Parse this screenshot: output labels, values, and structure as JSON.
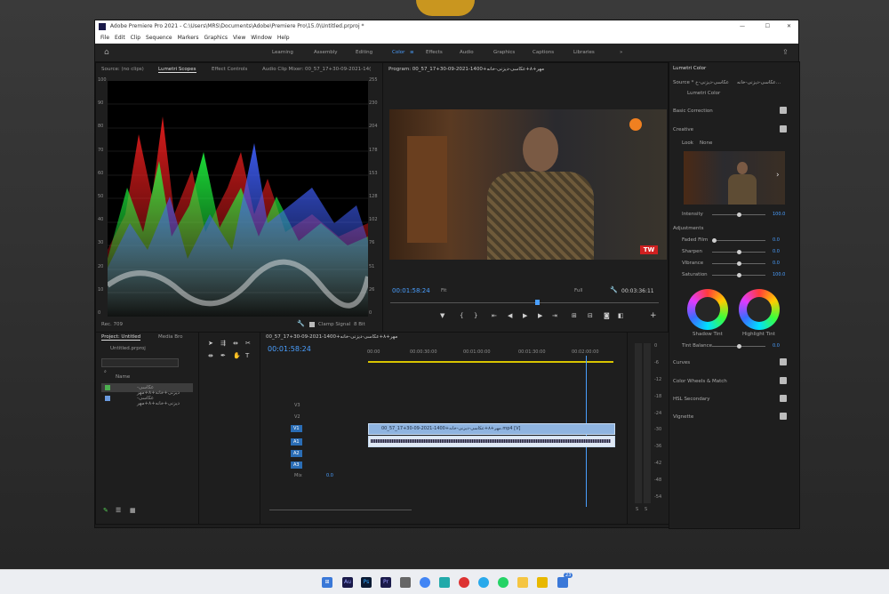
{
  "window": {
    "title": "Adobe Premiere Pro 2021 - C:\\Users\\MRS\\Documents\\Adobe\\Premiere Pro\\15.0\\Untitled.prproj *"
  },
  "menu": [
    "File",
    "Edit",
    "Clip",
    "Sequence",
    "Markers",
    "Graphics",
    "View",
    "Window",
    "Help"
  ],
  "workspaces": [
    "Learning",
    "Assembly",
    "Editing",
    "Color",
    "Effects",
    "Audio",
    "Graphics",
    "Captions",
    "Libraries"
  ],
  "source_panel": {
    "tabs": [
      "Source: (no clips)",
      "Lumetri Scopes",
      "Effect Controls",
      "Audio Clip Mixer: 00_57_17+30-09-2021-14("
    ],
    "left_scale": [
      "100",
      "90",
      "80",
      "70",
      "60",
      "50",
      "40",
      "30",
      "20",
      "10",
      "0"
    ],
    "right_scale": [
      "255",
      "230",
      "204",
      "178",
      "153",
      "128",
      "102",
      "76",
      "51",
      "26",
      "0"
    ],
    "footer_left": "Rec. 709",
    "clamp_label": "Clamp Signal",
    "bit_label": "8 Bit"
  },
  "program": {
    "title": "Program: 00_57_17+30-09-2021-1400+مهر+۸+عکاسی-دیزنی-خانه",
    "timecode": "00:01:58:24",
    "fit": "Fit",
    "quality": "Full",
    "duration": "00:03:36:11",
    "watermark": "TW"
  },
  "project": {
    "tabs": [
      "Project: Untitled",
      "Media Bro"
    ],
    "file": "Untitled.prproj",
    "column_name": "Name",
    "items": [
      "عکاسی-دیزنی+خانه+۸+مهر",
      "عکاسی-دیزنی+خانه+۸+مهر"
    ]
  },
  "timeline": {
    "tab": "00_57_17+30-09-2021-1400+مهر+۸+عکاسی-دیزنی-خانه",
    "timecode": "00:01:58:24",
    "ruler": [
      "00:00",
      "00:00:30:00",
      "00:01:00:00",
      "00:01:30:00",
      "00:02:00:00"
    ],
    "video_tracks": [
      "V3",
      "V2",
      "V1"
    ],
    "audio_tracks": [
      "A1",
      "A2",
      "A3"
    ],
    "mix_label": "Mix",
    "mix_value": "0.0",
    "video_clip": "00_57_17+30-09-2021-1400+مهر+۸+عکاسی-دیزنی-خانه.mp4 [V]",
    "meter_scale": [
      "0",
      "-6",
      "-12",
      "-18",
      "-24",
      "-30",
      "-36",
      "-42",
      "-48",
      "-54"
    ],
    "meter_solo": [
      "S",
      "S"
    ]
  },
  "lumetri": {
    "title": "Lumetri Color",
    "source": "Source * عکاسی-دیزنی-خ",
    "target": "عکاسی-دیزنی-خانه...",
    "effect": "Lumetri Color",
    "sections": [
      "Basic Correction",
      "Creative"
    ],
    "look_label": "Look",
    "look_value": "None",
    "intensity_label": "Intensity",
    "intensity_value": "100.0",
    "adjustments_label": "Adjustments",
    "adjustments": [
      {
        "label": "Faded Film",
        "value": "0.0",
        "level": 0.0
      },
      {
        "label": "Sharpen",
        "value": "0.0",
        "level": 0.5
      },
      {
        "label": "Vibrance",
        "value": "0.0",
        "level": 0.5
      },
      {
        "label": "Saturation",
        "value": "100.0",
        "level": 0.5
      }
    ],
    "shadow_tint": "Shadow Tint",
    "highlight_tint": "Highlight Tint",
    "tint_balance_label": "Tint Balance",
    "tint_balance_value": "0.0",
    "bottom_sections": [
      "Curves",
      "Color Wheels & Match",
      "HSL Secondary",
      "Vignette"
    ]
  },
  "taskbar": {
    "badge": "23",
    "apps": [
      "Au",
      "Ps",
      "Pr"
    ]
  },
  "colors": {
    "accent": "#4a9fff",
    "playhead": "#4a9fff",
    "clip_blue": "#8fb4e0"
  }
}
